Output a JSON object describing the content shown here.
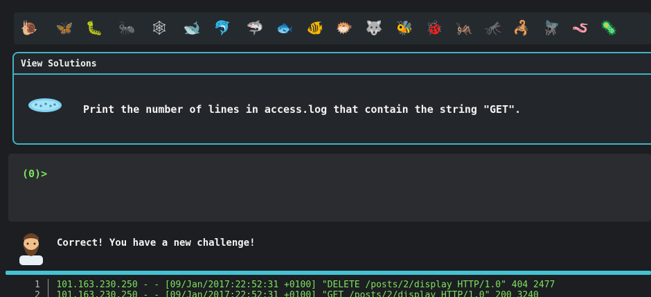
{
  "icon_bar": {
    "icons": [
      {
        "name": "snail-icon",
        "glyph": "🐌",
        "color": "#b9895a"
      },
      {
        "name": "butterfly-icon",
        "glyph": "🦋",
        "color": "#f08a3c"
      },
      {
        "name": "caterpillar-icon",
        "glyph": "🐛",
        "color": "#7cc447"
      },
      {
        "name": "ant-icon",
        "glyph": "🐜",
        "color": "#9b5d3f"
      },
      {
        "name": "spider-web-icon",
        "glyph": "🕸",
        "color": "#d6d6d6"
      },
      {
        "name": "whale-icon",
        "glyph": "🐋",
        "color": "#7ed2f0"
      },
      {
        "name": "dolphin-icon",
        "glyph": "🐬",
        "color": "#4aa9e0"
      },
      {
        "name": "shark-icon",
        "glyph": "🦈",
        "color": "#9fb6c4"
      },
      {
        "name": "fish-icon",
        "glyph": "🐟",
        "color": "#38b6e6"
      },
      {
        "name": "tropical-fish-icon",
        "glyph": "🐠",
        "color": "#f5c842"
      },
      {
        "name": "blowfish-icon",
        "glyph": "🐡",
        "color": "#b9895a"
      },
      {
        "name": "wolf-icon",
        "glyph": "🐺",
        "color": "#9aa3a8"
      },
      {
        "name": "bee-icon",
        "glyph": "🐝",
        "color": "#f5d742"
      },
      {
        "name": "ladybug-icon",
        "glyph": "🐞",
        "color": "#e24848"
      },
      {
        "name": "cricket-icon",
        "glyph": "🦗",
        "color": "#6fbf3d"
      },
      {
        "name": "mosquito-icon",
        "glyph": "🦟",
        "color": "#d0d0d0"
      },
      {
        "name": "scorpion-icon",
        "glyph": "🦂",
        "color": "#c0392b"
      },
      {
        "name": "fly-icon",
        "glyph": "🪰",
        "color": "#cfd6da"
      },
      {
        "name": "worm-icon",
        "glyph": "🪱",
        "color": "#e58aa8"
      },
      {
        "name": "microbe-icon",
        "glyph": "🦠",
        "color": "#7ed2f0"
      }
    ]
  },
  "challenge_panel": {
    "title": "View Solutions",
    "icon": "microbe-icon",
    "text": "Print the number of lines in access.log that contain the string \"GET\"."
  },
  "terminal": {
    "prompt": "(0)>"
  },
  "feedback": {
    "avatar": "bearded-person-avatar",
    "message": "Correct! You have a new challenge!"
  },
  "progress": {
    "value": 1.0,
    "color": "#44c2d2"
  },
  "log_preview": {
    "lines": [
      {
        "no": "1",
        "text": "101.163.230.250 - - [09/Jan/2017:22:52:31 +0100] \"DELETE /posts/2/display HTTP/1.0\" 404 2477"
      },
      {
        "no": "2",
        "text": "101.163.230.250 - - [09/Jan/2017:22:52:31 +0100] \"GET /posts/2/display HTTP/1.0\" 200 3240"
      }
    ]
  }
}
